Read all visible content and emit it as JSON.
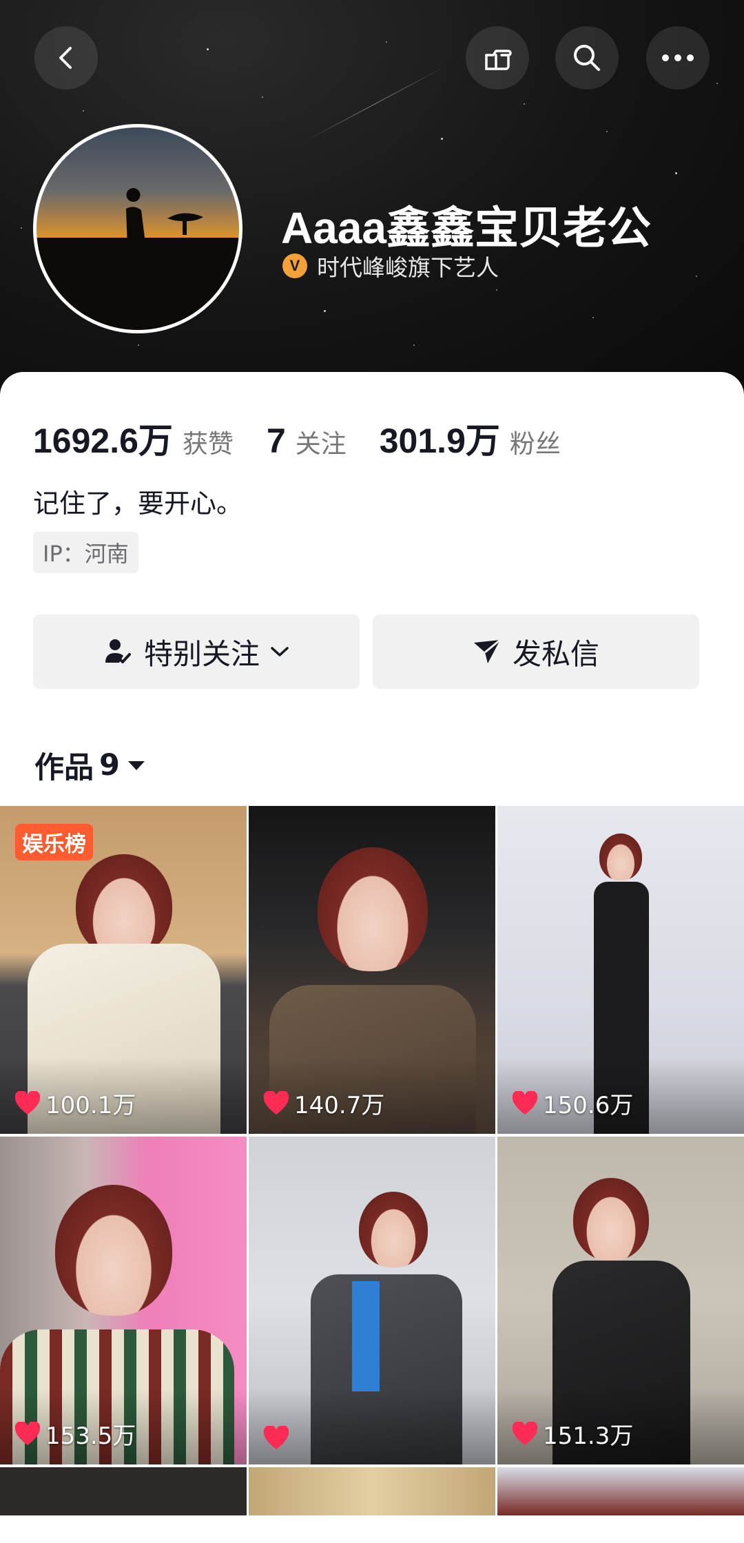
{
  "header": {
    "profile_name": "Aaaa鑫鑫宝贝老公",
    "verified_text": "时代峰峻旗下艺人",
    "verified_mark": "V"
  },
  "stats": {
    "likes_value": "1692.6万",
    "likes_label": "获赞",
    "following_value": "7",
    "following_label": "关注",
    "followers_value": "301.9万",
    "followers_label": "粉丝"
  },
  "bio": "记住了，要开心。",
  "ip_location": "IP：河南",
  "actions": {
    "follow_label": "特别关注",
    "message_label": "发私信"
  },
  "works_tab": {
    "label": "作品",
    "count": "9"
  },
  "videos": [
    {
      "likes": "100.1万",
      "badge": "娱乐榜"
    },
    {
      "likes": "140.7万"
    },
    {
      "likes": "150.6万"
    },
    {
      "likes": "153.5万"
    },
    {
      "likes": ""
    },
    {
      "likes": "151.3万"
    }
  ],
  "colors": {
    "accent_heart": "#fe2c55",
    "badge_orange": "#ff5b2e",
    "verified_gold": "#f3a23a"
  },
  "icons": [
    "back-arrow-icon",
    "pointing-hand-icon",
    "search-icon",
    "more-icon",
    "user-check-icon",
    "chevron-down-icon",
    "send-icon",
    "caret-down-icon",
    "heart-icon"
  ]
}
